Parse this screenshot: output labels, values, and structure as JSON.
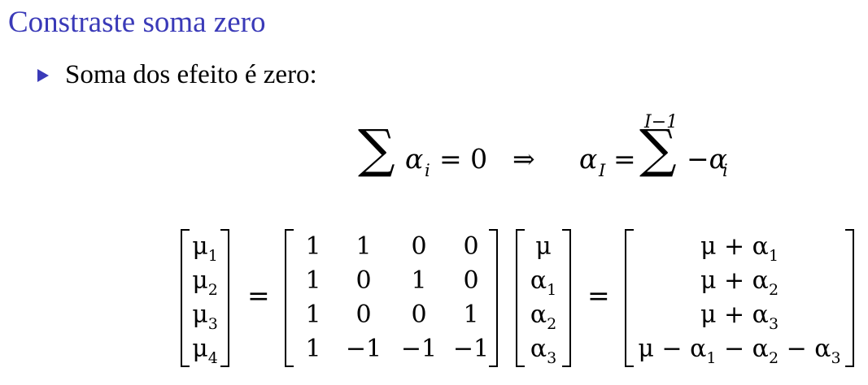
{
  "slide": {
    "title": "Constraste soma zero",
    "bullet": "Soma dos efeito é zero:"
  },
  "equation1": {
    "sum_symbol": "∑",
    "lhs_var": "α",
    "lhs_sub": "i",
    "equals_zero": "= 0",
    "implies": "⇒",
    "rhs_var": "α",
    "rhs_sub": "I",
    "equals": "=",
    "upper_limit": "I−1",
    "term": "−α",
    "term_sub": "i"
  },
  "equation2": {
    "mu_vector": [
      {
        "v": "μ",
        "s": "1"
      },
      {
        "v": "μ",
        "s": "2"
      },
      {
        "v": "μ",
        "s": "3"
      },
      {
        "v": "μ",
        "s": "4"
      }
    ],
    "equals": "=",
    "design_matrix": [
      [
        "1",
        "1",
        "0",
        "0"
      ],
      [
        "1",
        "0",
        "1",
        "0"
      ],
      [
        "1",
        "0",
        "0",
        "1"
      ],
      [
        "1",
        "−1",
        "−1",
        "−1"
      ]
    ],
    "param_vector": [
      {
        "v": "μ",
        "s": ""
      },
      {
        "v": "α",
        "s": "1"
      },
      {
        "v": "α",
        "s": "2"
      },
      {
        "v": "α",
        "s": "3"
      }
    ],
    "result_vector": [
      "μ + α1",
      "μ + α2",
      "μ + α3",
      "μ − α1 − α2 − α3"
    ]
  },
  "colors": {
    "title": "#3a3ab8",
    "bullet_marker": "#3a3ab8"
  }
}
